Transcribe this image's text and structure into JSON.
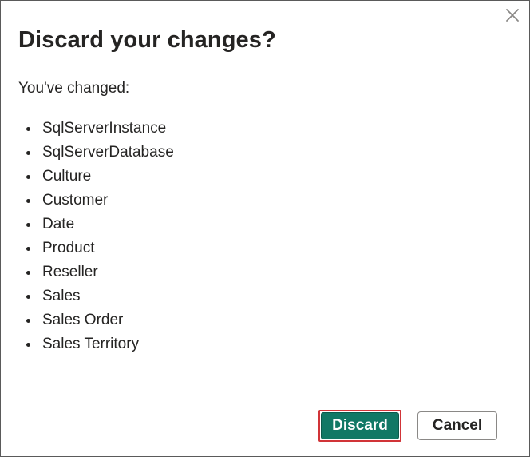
{
  "dialog": {
    "title": "Discard your changes?",
    "subtitle": "You've changed:",
    "close_icon": "close-icon",
    "changed_items": [
      "SqlServerInstance",
      "SqlServerDatabase",
      "Culture",
      "Customer",
      "Date",
      "Product",
      "Reseller",
      "Sales",
      "Sales Order",
      "Sales Territory"
    ],
    "buttons": {
      "discard_label": "Discard",
      "cancel_label": "Cancel"
    },
    "colors": {
      "primary": "#117865",
      "focus_outline": "#d13438",
      "text": "#252423",
      "border": "#8a8886"
    }
  }
}
